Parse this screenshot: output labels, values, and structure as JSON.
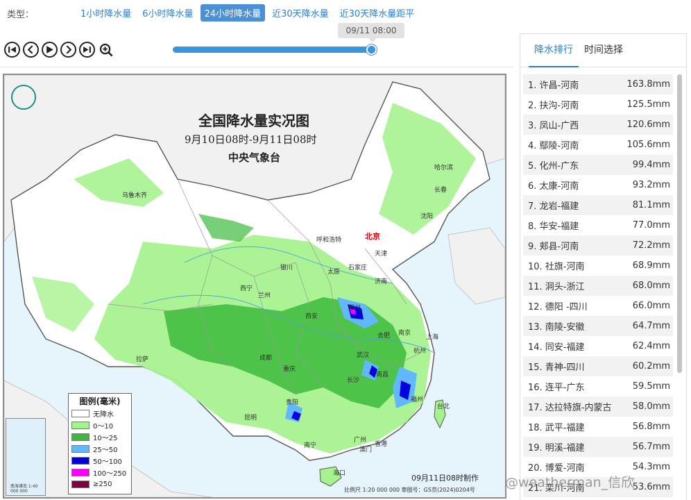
{
  "typebar": {
    "label": "类型：",
    "tabs": [
      "1小时降水量",
      "6小时降水量",
      "24小时降水量",
      "近30天降水量",
      "近30天降水量距平"
    ],
    "active_index": 2
  },
  "timeline": {
    "current_time": "09/11 08:00",
    "progress": 1.0
  },
  "controls": [
    "first-frame",
    "previous",
    "play",
    "next",
    "last-frame",
    "zoom-in"
  ],
  "map": {
    "title": "全国降水量实况图",
    "subtitle": "9月10日08时-9月11日08时",
    "agency": "中央气象台",
    "made_time": "09月11日08时制作",
    "scale_text": "比例尺 1:20 000 000    审图号：GS京(2024)0204号",
    "capital": "北京",
    "cities": [
      "乌鲁木齐",
      "哈尔滨",
      "长春",
      "沈阳",
      "呼和浩特",
      "天津",
      "银川",
      "太原",
      "石家庄",
      "济南",
      "西宁",
      "兰州",
      "西安",
      "郑州",
      "合肥",
      "南京",
      "上海",
      "杭州",
      "拉萨",
      "成都",
      "武汉",
      "重庆",
      "长沙",
      "南昌",
      "福州",
      "贵阳",
      "昆明",
      "台北",
      "南宁",
      "广州",
      "香港",
      "澳门",
      "海口"
    ],
    "legend": {
      "title": "图例(毫米)",
      "items": [
        {
          "label": "无降水",
          "color": "#ffffff"
        },
        {
          "label": "0～10",
          "color": "#a6f28f"
        },
        {
          "label": "10～25",
          "color": "#3dba3d"
        },
        {
          "label": "25～50",
          "color": "#61b8ff"
        },
        {
          "label": "50～100",
          "color": "#0000e1"
        },
        {
          "label": "100～250",
          "color": "#fa00fa"
        },
        {
          "label": "≥250",
          "color": "#800040"
        }
      ]
    },
    "inset_caption": "南海诸岛 1:40 000 000"
  },
  "panel": {
    "tabs": [
      "降水排行",
      "时间选择"
    ],
    "active_tab": 0,
    "rankings": [
      {
        "rank": "1.",
        "station": "许昌-河南",
        "value": "163.8mm"
      },
      {
        "rank": "2.",
        "station": "扶沟-河南",
        "value": "125.5mm"
      },
      {
        "rank": "3.",
        "station": "凤山-广西",
        "value": "120.6mm"
      },
      {
        "rank": "4.",
        "station": "鄢陵-河南",
        "value": "105.6mm"
      },
      {
        "rank": "5.",
        "station": "化州-广东",
        "value": "99.4mm"
      },
      {
        "rank": "6.",
        "station": "太康-河南",
        "value": "93.2mm"
      },
      {
        "rank": "7.",
        "station": "龙岩-福建",
        "value": "81.1mm"
      },
      {
        "rank": "8.",
        "station": "华安-福建",
        "value": "77.0mm"
      },
      {
        "rank": "9.",
        "station": "郏县-河南",
        "value": "72.2mm"
      },
      {
        "rank": "10.",
        "station": "社旗-河南",
        "value": "68.9mm"
      },
      {
        "rank": "11.",
        "station": "洞头-浙江",
        "value": "68.0mm"
      },
      {
        "rank": "12.",
        "station": "德阳 -四川",
        "value": "66.0mm"
      },
      {
        "rank": "13.",
        "station": "南陵-安徽",
        "value": "64.7mm"
      },
      {
        "rank": "14.",
        "station": "同安-福建",
        "value": "62.4mm"
      },
      {
        "rank": "15.",
        "station": "青神-四川",
        "value": "60.2mm"
      },
      {
        "rank": "16.",
        "station": "连平-广东",
        "value": "59.5mm"
      },
      {
        "rank": "17.",
        "station": "达拉特旗-内蒙古",
        "value": "58.0mm"
      },
      {
        "rank": "18.",
        "station": "武平-福建",
        "value": "56.8mm"
      },
      {
        "rank": "19.",
        "station": "明溪-福建",
        "value": "56.7mm"
      },
      {
        "rank": "20.",
        "station": "博爱-河南",
        "value": "54.3mm"
      },
      {
        "rank": "21.",
        "station": "栾川-河南",
        "value": "53.6mm"
      }
    ]
  },
  "watermark": "@weatherman_信欣"
}
